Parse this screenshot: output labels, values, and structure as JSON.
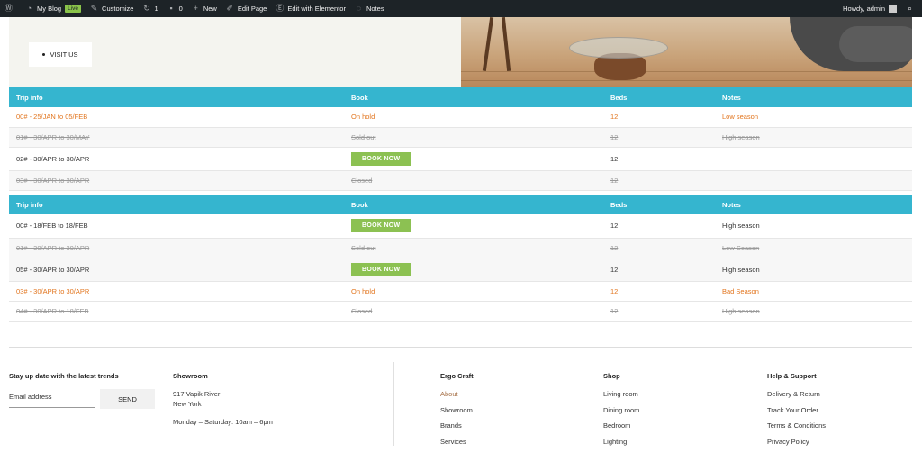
{
  "adminbar": {
    "site": "My Blog",
    "live": "Live",
    "customize": "Customize",
    "updates": "1",
    "comments": "0",
    "new": "New",
    "edit_page": "Edit Page",
    "elementor": "Edit with Elementor",
    "notes": "Notes",
    "howdy": "Howdy, admin",
    "icons": [
      "wordpress-icon",
      "dashboard-icon",
      "brush-icon",
      "updates-icon",
      "comment-icon",
      "plus-icon",
      "pencil-icon",
      "elementor-icon",
      "notes-icon",
      "search-icon"
    ]
  },
  "hero": {
    "visit_label": "VISIT US"
  },
  "table1": {
    "headers": [
      "Trip info",
      "Book",
      "Beds",
      "Notes"
    ],
    "rows": [
      {
        "trip": "00# - 25/JAN to 05/FEB",
        "book": "On hold",
        "beds": "12",
        "notes": "Low season"
      },
      {
        "trip": "01# - 30/APR to 30/MAY",
        "book": "Sold out",
        "beds": "12",
        "notes": "High season"
      },
      {
        "trip": "02# - 30/APR to 30/APR",
        "book": "BOOK NOW",
        "beds": "12",
        "notes": ""
      },
      {
        "trip": "03# - 30/APR to 30/APR",
        "book": "Closed",
        "beds": "12",
        "notes": ""
      }
    ]
  },
  "table2": {
    "headers": [
      "Trip info",
      "Book",
      "Beds",
      "Notes"
    ],
    "rows": [
      {
        "trip": "00# - 18/FEB to 18/FEB",
        "book": "BOOK NOW",
        "beds": "12",
        "notes": "High season"
      },
      {
        "trip": "01# - 30/APR to 30/APR",
        "book": "Sold out",
        "beds": "12",
        "notes": "Low Season"
      },
      {
        "trip": "05# - 30/APR to 30/APR",
        "book": "BOOK NOW",
        "beds": "12",
        "notes": "High season"
      },
      {
        "trip": "03# - 30/APR to 30/APR",
        "book": "On hold",
        "beds": "12",
        "notes": "Bad Season"
      },
      {
        "trip": "04# - 30/APR to 18/FEB",
        "book": "Closed",
        "beds": "12",
        "notes": "High season"
      }
    ]
  },
  "footer": {
    "newsletter_title": "Stay up date with the latest trends",
    "email_placeholder": "Email address",
    "send_label": "SEND",
    "showroom_title": "Showroom",
    "address_line1": "917 Vapik River",
    "address_line2": "New York",
    "hours": "Monday – Saturday: 10am – 6pm",
    "ergo": {
      "title": "Ergo Craft",
      "links": [
        "About",
        "Showroom",
        "Brands",
        "Services"
      ]
    },
    "shop": {
      "title": "Shop",
      "links": [
        "Living room",
        "Dining room",
        "Bedroom",
        "Lighting"
      ]
    },
    "help": {
      "title": "Help & Support",
      "links": [
        "Delivery & Return",
        "Track Your Order",
        "Terms & Conditions",
        "Privacy Policy"
      ]
    }
  },
  "colors": {
    "adminbar": "#1d2327",
    "header": "#35b5cf",
    "book": "#8cc152",
    "orange": "#e2751e",
    "live": "#8ac34a",
    "about_link": "#a8734a"
  }
}
